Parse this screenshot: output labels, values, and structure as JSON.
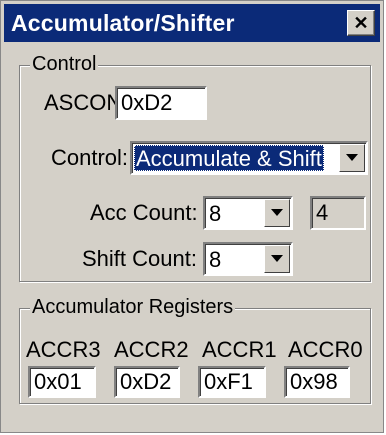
{
  "window": {
    "title": "Accumulator/Shifter",
    "close_glyph": "✕",
    "title_bar_color": "#0b2a78",
    "face_color": "#d4d0c8"
  },
  "control_group": {
    "label": "Control",
    "ascon_label": "ASCON:",
    "ascon_value": "0xD2",
    "control_label": "Control:",
    "control_value": "Accumulate & Shift",
    "acc_count_label": "Acc Count:",
    "acc_count_value": "8",
    "acc_count_readout": "4",
    "shift_count_label": "Shift Count:",
    "shift_count_value": "8"
  },
  "registers_group": {
    "label": "Accumulator Registers",
    "registers": [
      {
        "name": "ACCR3",
        "value": "0x01"
      },
      {
        "name": "ACCR2",
        "value": "0xD2"
      },
      {
        "name": "ACCR1",
        "value": "0xF1"
      },
      {
        "name": "ACCR0",
        "value": "0x98"
      }
    ]
  },
  "icons": {
    "close": "close-icon",
    "dropdown": "chevron-down-icon"
  }
}
